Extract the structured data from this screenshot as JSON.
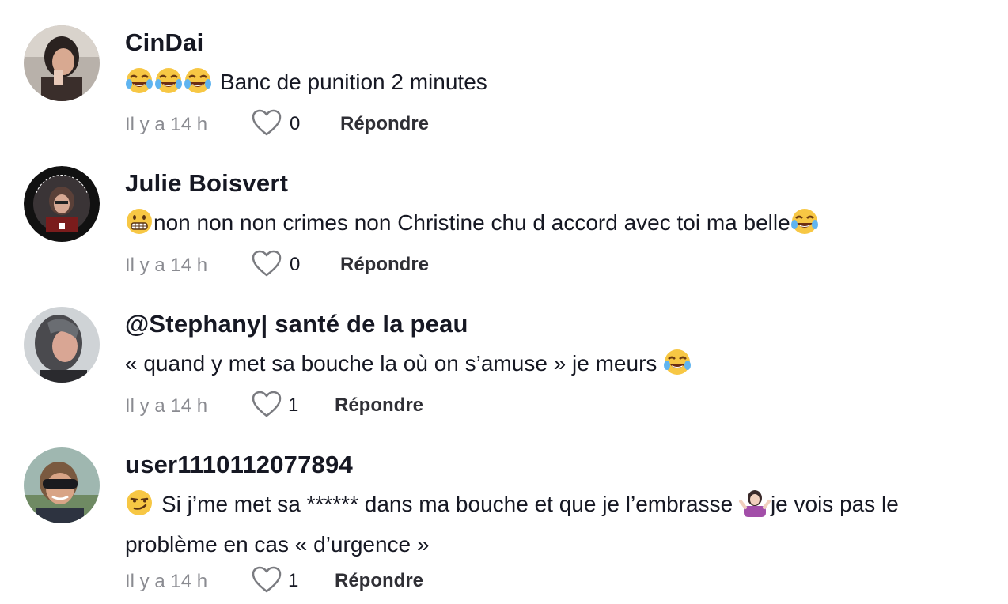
{
  "comments": [
    {
      "username": "CinDai",
      "text": "Banc de punition 2 minutes",
      "text_prefix_emojis": [
        "face-with-tears-of-joy-icon",
        "face-with-tears-of-joy-icon",
        "face-with-tears-of-joy-icon"
      ],
      "time": "Il y a 14 h",
      "likes": "0",
      "reply_label": "Répondre"
    },
    {
      "username": "Julie Boisvert",
      "text": "non non non crimes non Christine chu d accord avec toi ma belle",
      "text_prefix_emojis": [
        "grimacing-face-icon"
      ],
      "text_suffix_emojis": [
        "face-with-tears-of-joy-icon"
      ],
      "time": "Il y a 14 h",
      "likes": "0",
      "reply_label": "Répondre"
    },
    {
      "username": "@Stephany| santé de la peau",
      "text": "«  quand y met sa bouche la où on s’amuse » je meurs",
      "text_suffix_emojis": [
        "face-with-tears-of-joy-icon"
      ],
      "time": "Il y a 14 h",
      "likes": "1",
      "reply_label": "Répondre"
    },
    {
      "username": "user1110112077894",
      "text_part1": "Si j’me met sa ****** dans ma bouche et que je l’embrasse",
      "text_part2": "je vois pas le problème en cas « d’urgence »",
      "text_prefix_emojis": [
        "smirking-face-icon"
      ],
      "text_mid_emojis": [
        "woman-shrugging-icon"
      ],
      "time": "Il y a 14 h",
      "likes": "1",
      "reply_label": "Répondre"
    }
  ]
}
